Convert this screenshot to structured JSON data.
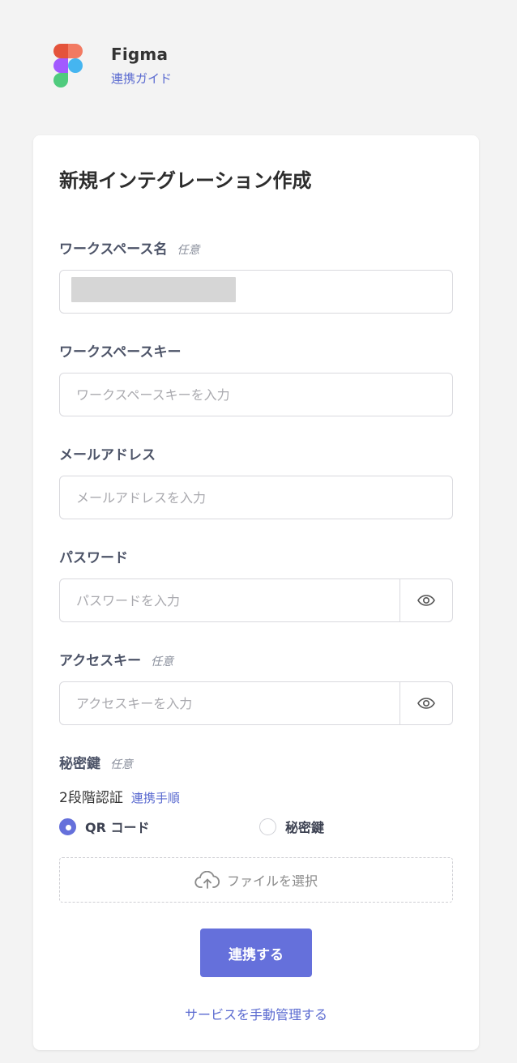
{
  "header": {
    "app_name": "Figma",
    "guide_link": "連携ガイド"
  },
  "card": {
    "title": "新規インテグレーション作成",
    "workspace_name": {
      "label": "ワークスペース名",
      "optional": "任意",
      "value": ""
    },
    "workspace_key": {
      "label": "ワークスペースキー",
      "placeholder": "ワークスペースキーを入力"
    },
    "email": {
      "label": "メールアドレス",
      "placeholder": "メールアドレスを入力"
    },
    "password": {
      "label": "パスワード",
      "placeholder": "パスワードを入力"
    },
    "access_key": {
      "label": "アクセスキー",
      "optional": "任意",
      "placeholder": "アクセスキーを入力"
    },
    "secret_key": {
      "label": "秘密鍵",
      "optional": "任意"
    },
    "two_factor": {
      "label": "2段階認証",
      "link": "連携手順",
      "options": [
        {
          "label": "QR コード",
          "selected": true
        },
        {
          "label": "秘密鍵",
          "selected": false
        }
      ]
    },
    "file_upload": {
      "label": "ファイルを選択"
    },
    "submit_label": "連携する",
    "manual_link": "サービスを手動管理する"
  },
  "colors": {
    "accent": "#6570db",
    "link": "#5a6ad0",
    "background": "#f3f3f3"
  }
}
